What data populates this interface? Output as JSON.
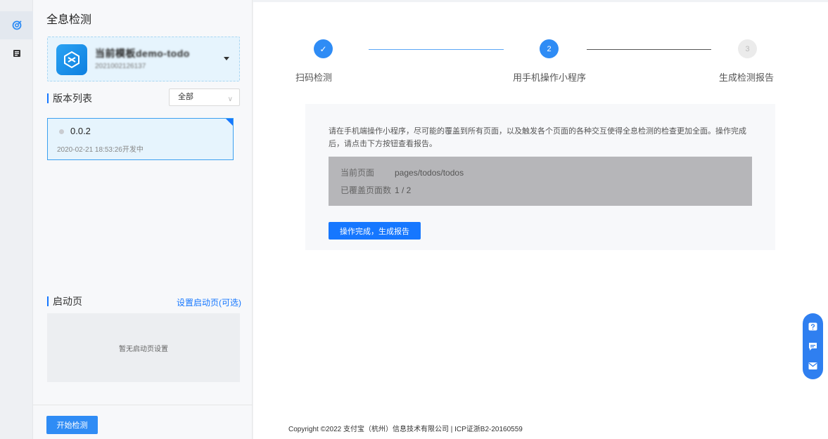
{
  "colors": {
    "primary": "#1677ff",
    "active_step": "#2f8cf5",
    "pending_step": "#e9e9e9"
  },
  "rail": {
    "items": [
      {
        "icon": "detect-icon",
        "active": true
      },
      {
        "icon": "report-list-icon",
        "active": false
      }
    ]
  },
  "sidebar": {
    "title": "全息检测",
    "app": {
      "name": "当前模板demo-todo",
      "id": "2021002126137"
    },
    "version_list": {
      "heading": "版本列表",
      "filter_value": "全部",
      "items": [
        {
          "version": "0.0.2",
          "meta": "2020-02-21 18:53:26开发中"
        }
      ]
    },
    "launch": {
      "heading": "启动页",
      "set_link": "设置启动页(可选)",
      "empty_text": "暂无启动页设置"
    },
    "start_button": "开始检测"
  },
  "steps": [
    {
      "label": "扫码检测",
      "marker": "✓",
      "state": "done"
    },
    {
      "label": "用手机操作小程序",
      "marker": "2",
      "state": "active"
    },
    {
      "label": "生成检测报告",
      "marker": "3",
      "state": "pending"
    }
  ],
  "panel": {
    "description": "请在手机端操作小程序，尽可能的覆盖到所有页面，以及触发各个页面的各种交互使得全息检测的检查更加全面。操作完成后，请点击下方按钮查看报告。",
    "current_page_label": "当前页面",
    "current_page_value": "pages/todos/todos",
    "coverage_label": "已覆盖页面数",
    "coverage_value": "1 / 2",
    "done_button": "操作完成，生成报告"
  },
  "footer": {
    "copyright": "Copyright ©2022 支付宝（杭州）信息技术有限公司 | ICP证浙B2-20160559"
  },
  "float_toolbar": {
    "items": [
      "help-icon",
      "chat-icon",
      "feedback-icon"
    ]
  }
}
